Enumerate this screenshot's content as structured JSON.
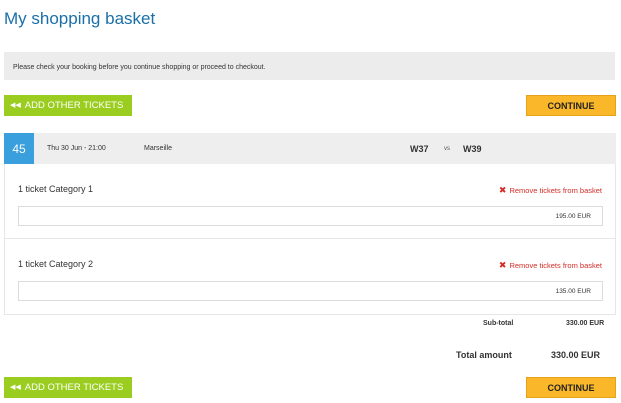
{
  "page": {
    "title": "My shopping basket"
  },
  "notice": {
    "text": "Please check your booking before you continue shopping or proceed to checkout."
  },
  "actions": {
    "add_tickets_label": "ADD OTHER TICKETS",
    "add_tickets_icon": "double-chevron-left-icon",
    "continue_label": "CONTINUE"
  },
  "match": {
    "number": "45",
    "datetime": "Thu 30 Jun - 21:00",
    "venue": "Marseille",
    "team1": "W37",
    "vs": "vs",
    "team2": "W39"
  },
  "tickets": [
    {
      "name": "1 ticket Category 1",
      "remove_label": "Remove tickets from basket",
      "price": "195.00 EUR"
    },
    {
      "name": "1 ticket Category 2",
      "remove_label": "Remove tickets from basket",
      "price": "135.00 EUR"
    }
  ],
  "summary": {
    "subtotal_label": "Sub-total",
    "subtotal_value": "330.00 EUR",
    "total_label": "Total amount",
    "total_value": "330.00 EUR"
  },
  "colors": {
    "title": "#1a6fa8",
    "green_button": "#9acd1f",
    "orange_button": "#fbb72a",
    "match_number_bg": "#3a9fdd",
    "remove_red": "#d32d27"
  }
}
